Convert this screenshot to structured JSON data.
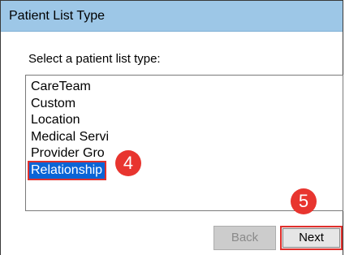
{
  "dialog": {
    "title": "Patient List Type",
    "prompt": "Select a patient list type:",
    "list_items": [
      "CareTeam",
      "Custom",
      "Location",
      "Medical Servi",
      "Provider Gro",
      "Relationship"
    ],
    "selected_item": "Relationship",
    "buttons": {
      "back_label": "Back",
      "next_label": "Next"
    }
  },
  "annotations": {
    "step_4": "4",
    "step_5": "5",
    "marker_color": "#e8352f"
  },
  "colors": {
    "titlebar": "#9dc7e7",
    "selection": "#0a64d6",
    "highlight_border": "#e0302c"
  }
}
